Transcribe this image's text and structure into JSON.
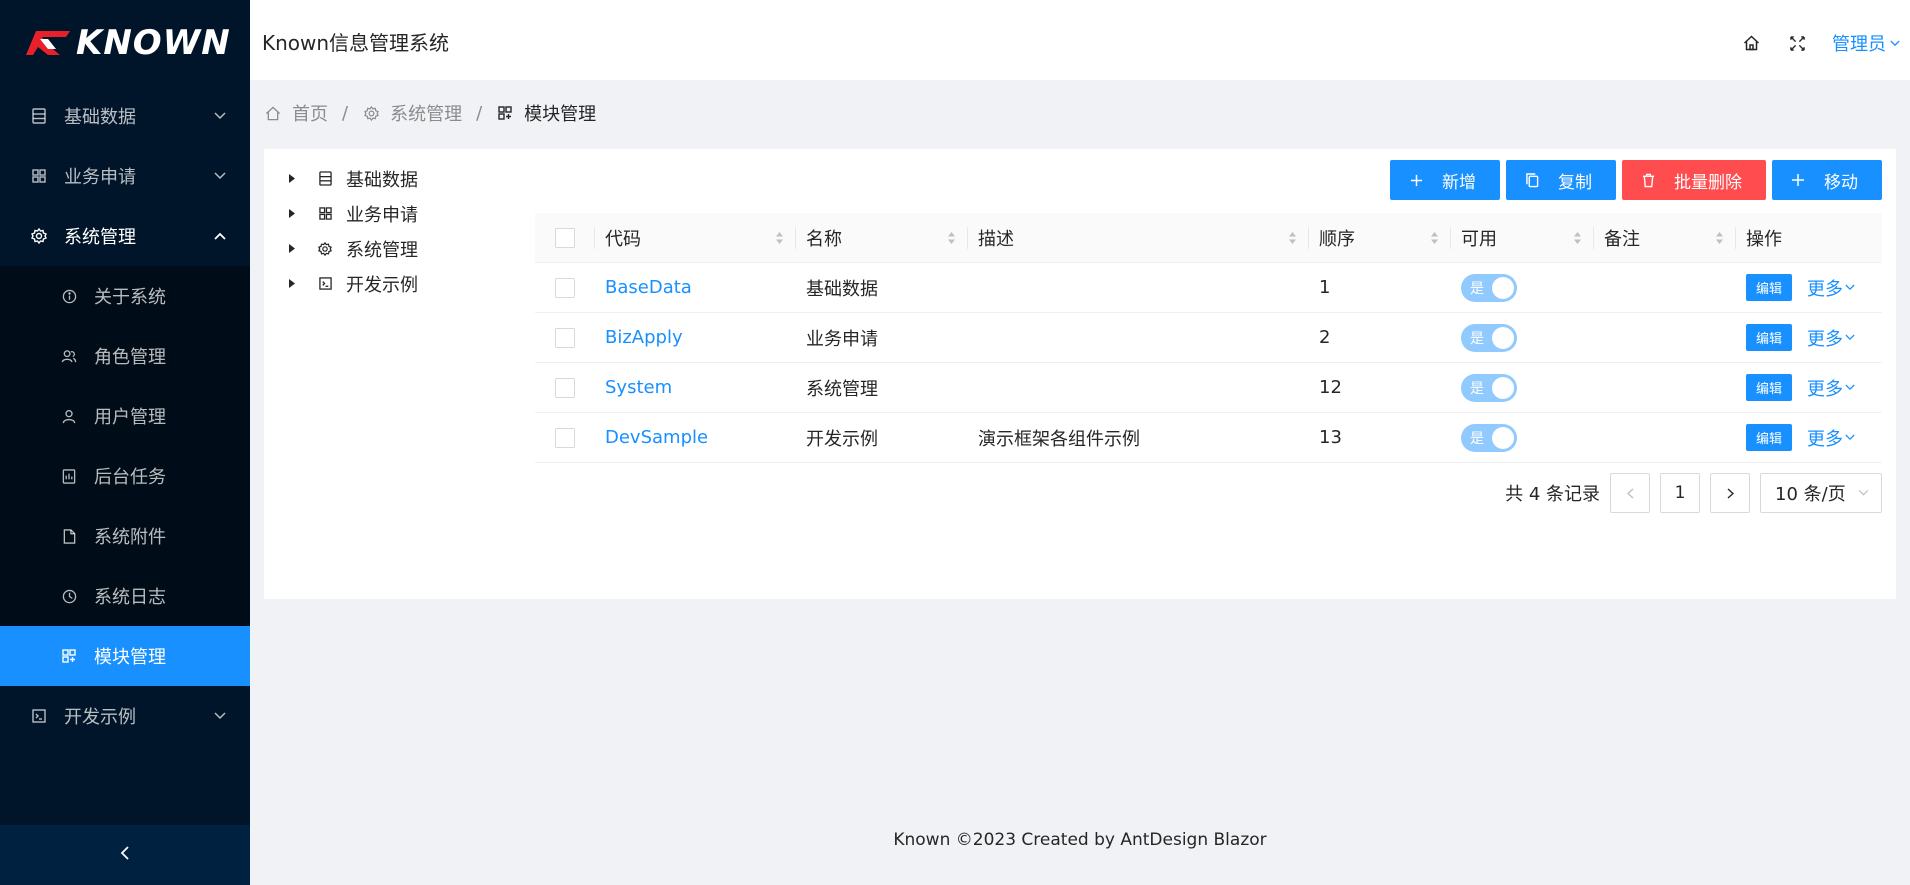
{
  "brand": {
    "logo_text": "KNOWN"
  },
  "sidebar": {
    "menu": [
      {
        "label": "基础数据",
        "icon": "database-icon"
      },
      {
        "label": "业务申请",
        "icon": "appstore-icon"
      },
      {
        "label": "系统管理",
        "icon": "setting-icon"
      }
    ],
    "system_submenu": [
      {
        "label": "关于系统",
        "icon": "info-circle-icon"
      },
      {
        "label": "角色管理",
        "icon": "team-icon"
      },
      {
        "label": "用户管理",
        "icon": "user-icon"
      },
      {
        "label": "后台任务",
        "icon": "task-icon"
      },
      {
        "label": "系统附件",
        "icon": "file-icon"
      },
      {
        "label": "系统日志",
        "icon": "clock-icon"
      },
      {
        "label": "模块管理",
        "icon": "module-icon",
        "selected": true
      }
    ],
    "dev": {
      "label": "开发示例",
      "icon": "code-icon"
    }
  },
  "header": {
    "title": "Known信息管理系统",
    "user": "管理员"
  },
  "breadcrumb": [
    {
      "label": "首页",
      "icon": "home-icon"
    },
    {
      "label": "系统管理",
      "icon": "setting-icon"
    },
    {
      "label": "模块管理",
      "icon": "module-icon"
    }
  ],
  "tree": [
    {
      "label": "基础数据",
      "icon": "database-icon"
    },
    {
      "label": "业务申请",
      "icon": "appstore-icon"
    },
    {
      "label": "系统管理",
      "icon": "setting-icon"
    },
    {
      "label": "开发示例",
      "icon": "code-icon"
    }
  ],
  "toolbar": {
    "add": "新增",
    "copy": "复制",
    "batch_delete": "批量删除",
    "move": "移动"
  },
  "table": {
    "columns": [
      "代码",
      "名称",
      "描述",
      "顺序",
      "可用",
      "备注",
      "操作"
    ],
    "rows": [
      {
        "code": "BaseData",
        "name": "基础数据",
        "desc": "",
        "order": "1",
        "enabled": "是",
        "note": ""
      },
      {
        "code": "BizApply",
        "name": "业务申请",
        "desc": "",
        "order": "2",
        "enabled": "是",
        "note": ""
      },
      {
        "code": "System",
        "name": "系统管理",
        "desc": "",
        "order": "12",
        "enabled": "是",
        "note": ""
      },
      {
        "code": "DevSample",
        "name": "开发示例",
        "desc": "演示框架各组件示例",
        "order": "13",
        "enabled": "是",
        "note": ""
      }
    ],
    "edit_label": "编辑",
    "more_label": "更多"
  },
  "pagination": {
    "total_text": "共 4 条记录",
    "current_page": "1",
    "page_size": "10 条/页"
  },
  "footer": {
    "text": "Known ©2023 Created by AntDesign Blazor"
  },
  "colors": {
    "primary": "#1890ff",
    "danger": "#ff4d4f",
    "sider": "#001529"
  }
}
